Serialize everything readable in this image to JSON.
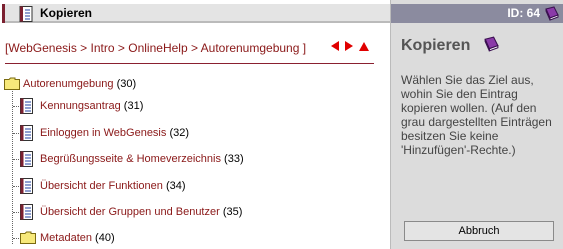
{
  "header": {
    "title": "Kopieren",
    "id_label": "ID: 64"
  },
  "breadcrumb": {
    "open": "[",
    "items": [
      "WebGenesis",
      "Intro",
      "OnlineHelp",
      "Autorenumgebung"
    ],
    "separator": ">",
    "close": "]"
  },
  "tree": {
    "root": {
      "label": "Autorenumgebung",
      "count": "(30)",
      "icon": "folder-icon"
    },
    "children": [
      {
        "label": "Kennungsantrag",
        "count": "(31)",
        "icon": "document-icon"
      },
      {
        "label": "Einloggen in WebGenesis",
        "count": "(32)",
        "icon": "document-icon"
      },
      {
        "label": "Begrüßungsseite & Homeverzeichnis",
        "count": "(33)",
        "icon": "document-icon"
      },
      {
        "label": "Übersicht der Funktionen",
        "count": "(34)",
        "icon": "document-icon"
      },
      {
        "label": "Übersicht der Gruppen und Benutzer",
        "count": "(35)",
        "icon": "document-icon"
      },
      {
        "label": "Metadaten",
        "count": "(40)",
        "icon": "folder-icon"
      }
    ]
  },
  "panel": {
    "title": "Kopieren",
    "description": "Wählen Sie das Ziel aus, wohin Sie den Eintrag kopieren wollen. (Auf den grau dargestellten Einträgen besitzen Sie keine 'Hinzufügen'-Rechte.)",
    "cancel_label": "Abbruch"
  },
  "colors": {
    "accent": "#8a1818",
    "arrow": "#e00000",
    "id_bar": "#8b8b9f",
    "panel_bg": "#dcdcdc"
  }
}
